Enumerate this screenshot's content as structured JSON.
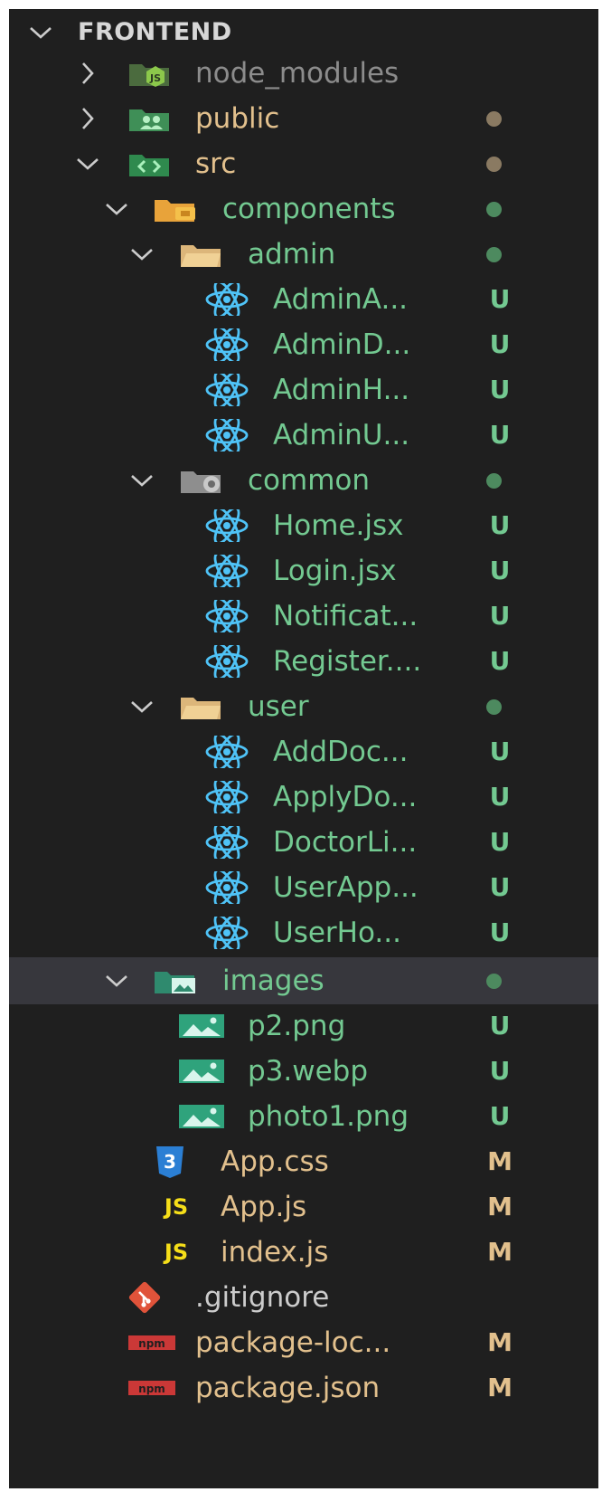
{
  "explorer": {
    "root_label": "FRONTEND",
    "items": [
      {
        "label": "node_modules",
        "status": "",
        "kind": "folder-node"
      },
      {
        "label": "public",
        "status": "",
        "kind": "folder-public"
      },
      {
        "label": "src",
        "status": "",
        "kind": "folder-src"
      },
      {
        "label": "components",
        "status": "",
        "kind": "folder-components"
      },
      {
        "label": "admin",
        "status": "",
        "kind": "folder"
      },
      {
        "label": "AdminA...",
        "status": "U",
        "kind": "react"
      },
      {
        "label": "AdminD...",
        "status": "U",
        "kind": "react"
      },
      {
        "label": "AdminH...",
        "status": "U",
        "kind": "react"
      },
      {
        "label": "AdminU...",
        "status": "U",
        "kind": "react"
      },
      {
        "label": "common",
        "status": "",
        "kind": "folder-common"
      },
      {
        "label": "Home.jsx",
        "status": "U",
        "kind": "react"
      },
      {
        "label": "Login.jsx",
        "status": "U",
        "kind": "react"
      },
      {
        "label": "Notificat...",
        "status": "U",
        "kind": "react"
      },
      {
        "label": "Register....",
        "status": "U",
        "kind": "react"
      },
      {
        "label": "user",
        "status": "",
        "kind": "folder"
      },
      {
        "label": "AddDoc...",
        "status": "U",
        "kind": "react"
      },
      {
        "label": "ApplyDo...",
        "status": "U",
        "kind": "react"
      },
      {
        "label": "DoctorLi...",
        "status": "U",
        "kind": "react"
      },
      {
        "label": "UserApp...",
        "status": "U",
        "kind": "react"
      },
      {
        "label": "UserHo...",
        "status": "U",
        "kind": "react"
      },
      {
        "label": "images",
        "status": "",
        "kind": "folder-images"
      },
      {
        "label": "p2.png",
        "status": "U",
        "kind": "image"
      },
      {
        "label": "p3.webp",
        "status": "U",
        "kind": "image"
      },
      {
        "label": "photo1.png",
        "status": "U",
        "kind": "image"
      },
      {
        "label": "App.css",
        "status": "M",
        "kind": "css"
      },
      {
        "label": "App.js",
        "status": "M",
        "kind": "js"
      },
      {
        "label": "index.js",
        "status": "M",
        "kind": "js"
      },
      {
        "label": ".gitignore",
        "status": "",
        "kind": "git"
      },
      {
        "label": "package-loc...",
        "status": "M",
        "kind": "npm"
      },
      {
        "label": "package.json",
        "status": "M",
        "kind": "npm"
      }
    ],
    "js_icon_text": "JS",
    "css_icon_text": "3",
    "npm_icon_text": "npm"
  },
  "colors": {
    "background": "#1f1f1f",
    "untracked_green": "#73c991",
    "modified_tan": "#e2c08d",
    "ignored_gray": "#8c8c8c",
    "selection": "#37373d"
  }
}
